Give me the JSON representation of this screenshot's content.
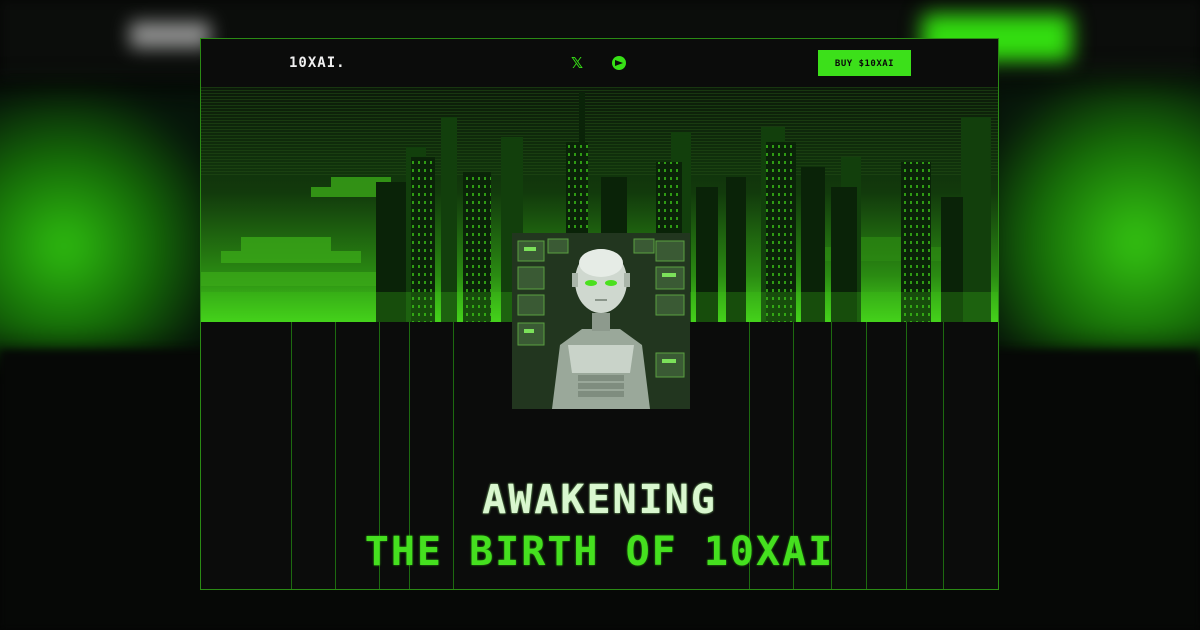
{
  "nav": {
    "logo": "10XAI.",
    "social": [
      {
        "icon": "x-logo-icon",
        "glyph": "𝕏"
      },
      {
        "icon": "telegram-icon"
      }
    ],
    "buy_label": "BUY $10XAI >>>"
  },
  "hero": {
    "title_line1": "AWAKENING",
    "title_line2": "THE BIRTH OF 10XAI"
  },
  "colors": {
    "accent": "#3ce01a",
    "border": "#2a8a14",
    "background": "#0c0d0c"
  }
}
